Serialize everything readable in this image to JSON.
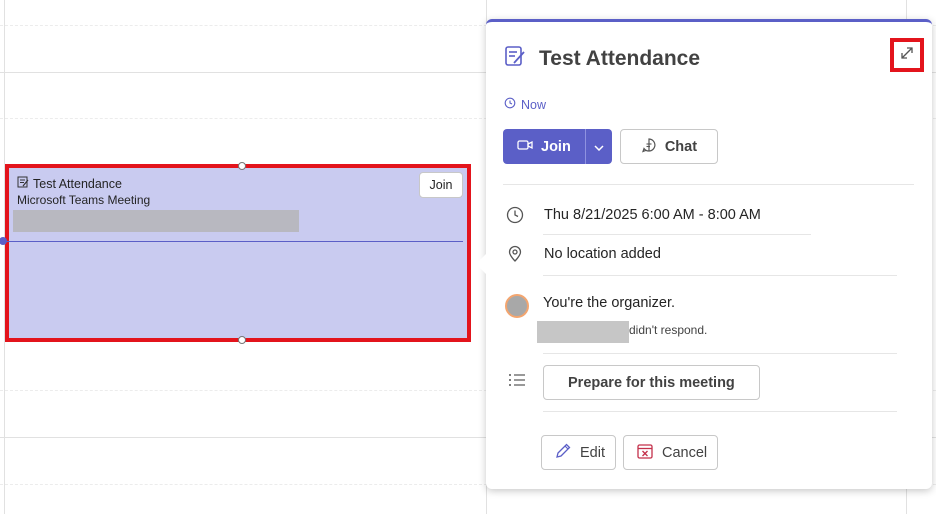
{
  "event_block": {
    "title": "Test Attendance",
    "subtitle": "Microsoft Teams Meeting",
    "join_label": "Join"
  },
  "card": {
    "title": "Test Attendance",
    "status": "Now",
    "join_label": "Join",
    "chat_label": "Chat",
    "datetime": "Thu 8/21/2025 6:00 AM - 8:00 AM",
    "location": "No location added",
    "organizer_text": "You're the organizer.",
    "response_text": "didn't respond.",
    "prepare_label": "Prepare for this meeting",
    "edit_label": "Edit",
    "cancel_label": "Cancel"
  },
  "colors": {
    "accent": "#5b5fc7",
    "event_fill": "#c9cbf0",
    "highlight": "#e3141c",
    "cancel_icon": "#c4314b"
  },
  "icons": {
    "title_icon": "notes-icon",
    "expand_icon": "expand-icon",
    "clock_icon": "clock-icon",
    "location_icon": "location-icon",
    "agenda_icon": "list-icon",
    "video_icon": "video-icon",
    "chat_icon": "chat-icon",
    "edit_icon": "pencil-icon",
    "cancel_icon": "calendar-cancel-icon"
  }
}
